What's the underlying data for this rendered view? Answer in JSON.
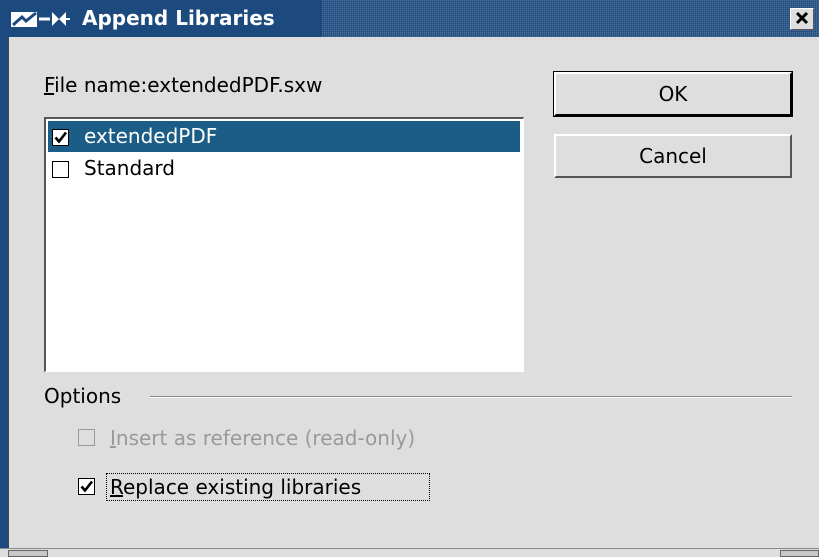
{
  "window": {
    "title": "Append Libraries",
    "icons": [
      "app-icon",
      "pin-icon"
    ],
    "close_icon": "close-icon"
  },
  "file_label": {
    "mnemonic": "F",
    "rest": "ile name:extendedPDF.sxw"
  },
  "libraries": [
    {
      "name": "extendedPDF",
      "checked": true,
      "selected": true
    },
    {
      "name": "Standard",
      "checked": false,
      "selected": false
    }
  ],
  "buttons": {
    "ok": "OK",
    "cancel": "Cancel"
  },
  "options": {
    "label": "Options",
    "insert_reference": {
      "mnemonic": "I",
      "rest": "nsert as reference (read-only)",
      "checked": false,
      "enabled": false
    },
    "replace_existing": {
      "mnemonic": "R",
      "rest": "eplace existing libraries",
      "checked": true,
      "enabled": true
    }
  },
  "colors": {
    "titlebar": "#1c4a7e",
    "selection": "#1b5d86",
    "dialog_bg": "#dedede"
  }
}
